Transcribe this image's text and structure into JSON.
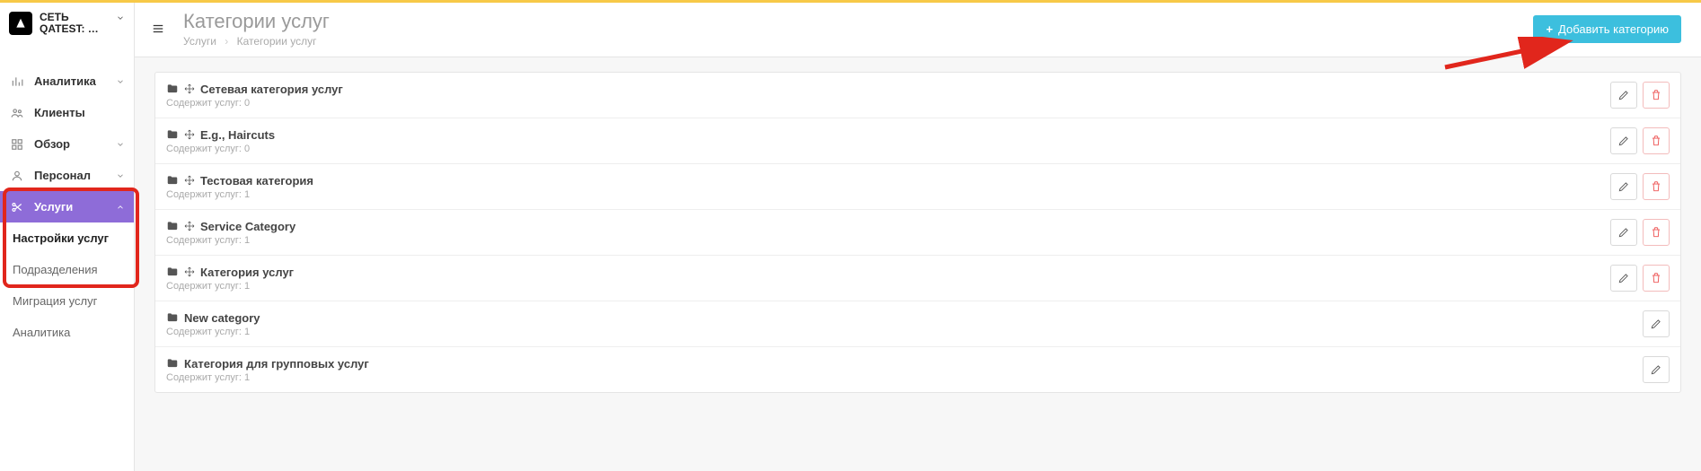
{
  "brand": {
    "line1": "СЕТЬ",
    "line2": "QATEST: …"
  },
  "sidebar": {
    "analytics": "Аналитика",
    "clients": "Клиенты",
    "overview": "Обзор",
    "staff": "Персонал",
    "services": "Услуги",
    "sub_settings": "Настройки услуг",
    "sub_departments": "Подразделения",
    "sub_migration": "Миграция услуг",
    "sub_analytics": "Аналитика"
  },
  "header": {
    "title": "Категории услуг",
    "crumb_root": "Услуги",
    "crumb_current": "Категории услуг",
    "add_button": "Добавить категорию"
  },
  "meta_prefix": "Содержит услуг: ",
  "categories": [
    {
      "name": "Сетевая категория услуг",
      "count": 0,
      "move": true,
      "delete": true
    },
    {
      "name": "E.g., Haircuts",
      "count": 0,
      "move": true,
      "delete": true
    },
    {
      "name": "Тестовая категория",
      "count": 1,
      "move": true,
      "delete": true
    },
    {
      "name": "Service Category",
      "count": 1,
      "move": true,
      "delete": true
    },
    {
      "name": "Категория услуг",
      "count": 1,
      "move": true,
      "delete": true
    },
    {
      "name": "New category",
      "count": 1,
      "move": false,
      "delete": false
    },
    {
      "name": "Категория для групповых услуг",
      "count": 1,
      "move": false,
      "delete": false
    }
  ]
}
